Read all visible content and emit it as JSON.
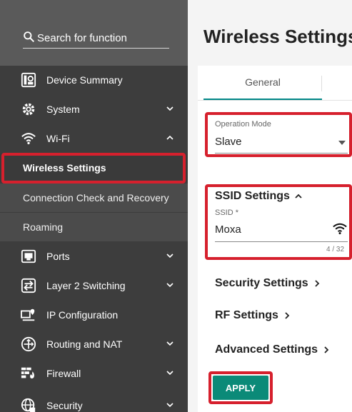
{
  "search": {
    "placeholder": "Search for function"
  },
  "sidebar": {
    "items": [
      {
        "label": "Device Summary",
        "icon": "device-summary-icon"
      },
      {
        "label": "System",
        "icon": "gear-icon"
      },
      {
        "label": "Wi-Fi",
        "icon": "wifi-icon"
      },
      {
        "label": "Ports",
        "icon": "ports-icon"
      },
      {
        "label": "Layer 2 Switching",
        "icon": "switching-icon"
      },
      {
        "label": "IP Configuration",
        "icon": "ip-config-icon"
      },
      {
        "label": "Routing and NAT",
        "icon": "routing-icon"
      },
      {
        "label": "Firewall",
        "icon": "firewall-icon"
      },
      {
        "label": "Security",
        "icon": "globe-lock-icon"
      }
    ],
    "wifi_sub": [
      {
        "label": "Wireless Settings",
        "active": true
      },
      {
        "label": "Connection Check and Recovery",
        "active": false
      },
      {
        "label": "Roaming",
        "active": false
      }
    ]
  },
  "main": {
    "title": "Wireless Settings",
    "tabs": [
      {
        "label": "General",
        "active": true
      }
    ],
    "operation_mode": {
      "label": "Operation Mode",
      "value": "Slave"
    },
    "ssid_section": {
      "title": "SSID Settings",
      "field_label": "SSID *",
      "value": "Moxa",
      "counter": "4 / 32"
    },
    "sections": [
      {
        "title": "Security Settings"
      },
      {
        "title": "RF Settings"
      },
      {
        "title": "Advanced Settings"
      }
    ],
    "apply_label": "APPLY"
  },
  "colors": {
    "accent": "#0b8a78",
    "highlight": "#d6202d",
    "sidebar_bg": "#3d3d3d"
  }
}
